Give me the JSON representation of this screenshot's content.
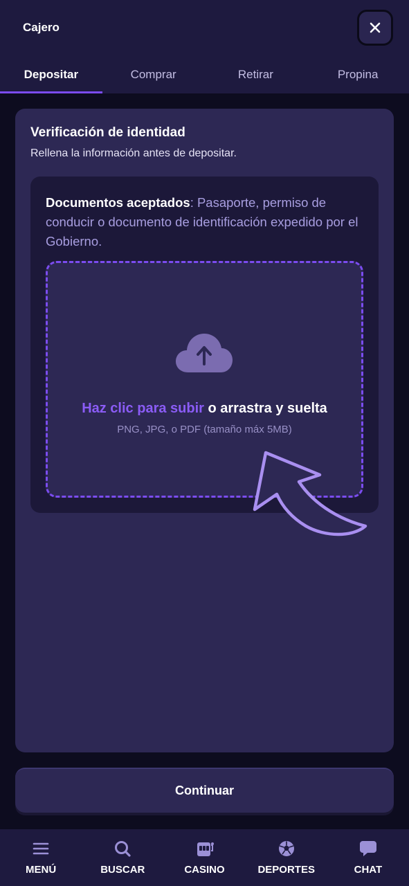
{
  "header": {
    "title": "Cajero",
    "close_icon": "close-icon"
  },
  "tabs": [
    {
      "label": "Depositar",
      "active": true
    },
    {
      "label": "Comprar",
      "active": false
    },
    {
      "label": "Retirar",
      "active": false
    },
    {
      "label": "Propina",
      "active": false
    }
  ],
  "card": {
    "title": "Verificación de identidad",
    "subtitle": "Rellena la información antes de depositar.",
    "docs_label": "Documentos aceptados",
    "docs_sep": ": ",
    "docs_text": "Pasaporte, permiso de conducir o documento de identificación expedido por el Gobierno.",
    "upload_link": "Haz clic para subir",
    "upload_rest": " o arrastra y suelta",
    "upload_hint": "PNG, JPG, o PDF (tamaño máx 5MB)",
    "upload_icon": "cloud-upload-icon"
  },
  "continue_label": "Continuar",
  "bottom_nav": [
    {
      "label": "MENÚ",
      "icon": "menu-icon"
    },
    {
      "label": "BUSCAR",
      "icon": "search-icon"
    },
    {
      "label": "CASINO",
      "icon": "slot-machine-icon"
    },
    {
      "label": "DEPORTES",
      "icon": "soccer-ball-icon"
    },
    {
      "label": "CHAT",
      "icon": "chat-icon"
    }
  ],
  "colors": {
    "accent": "#7b4cf0",
    "link": "#8b5cf6",
    "panel": "#2d2854",
    "header": "#1e1a3f",
    "background": "#0d0c1f"
  }
}
